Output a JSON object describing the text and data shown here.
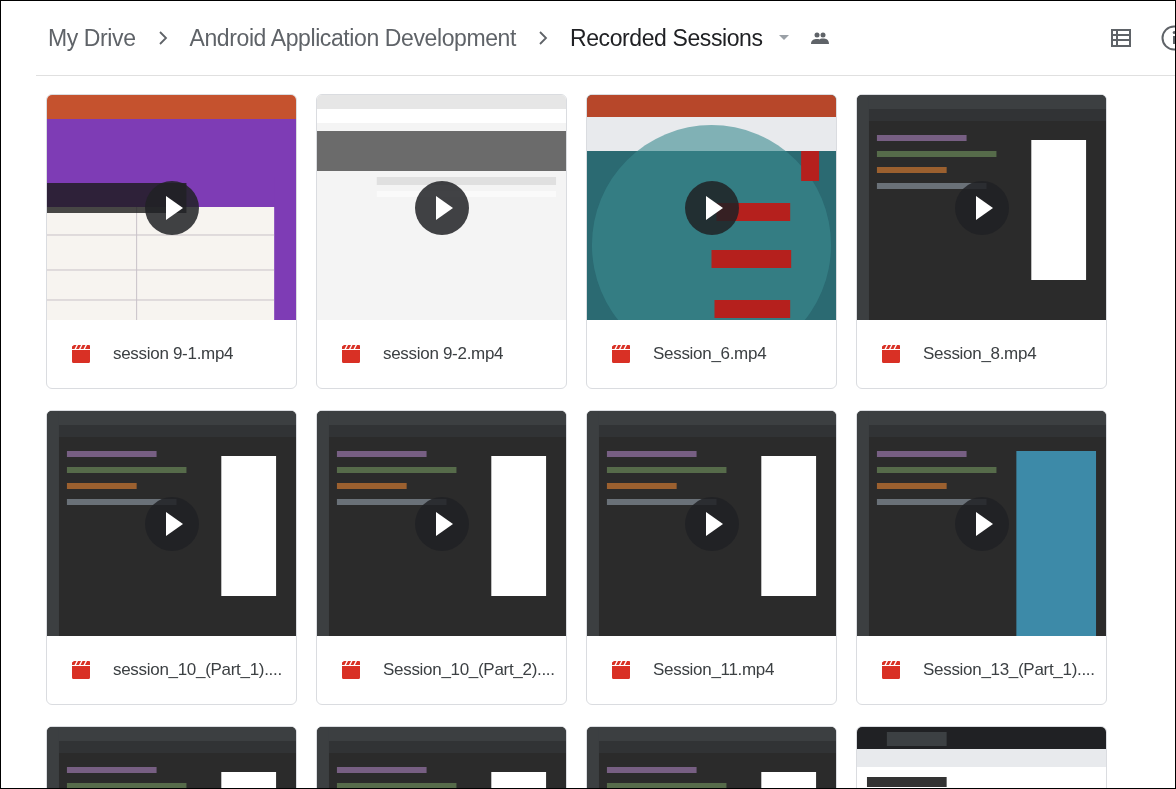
{
  "breadcrumb": [
    {
      "label": "My Drive",
      "current": false
    },
    {
      "label": "Android Application Development",
      "current": false
    },
    {
      "label": "Recorded Sessions",
      "current": true
    }
  ],
  "files": [
    {
      "name": "session 9-1.mp4",
      "kind": "video"
    },
    {
      "name": "session 9-2.mp4",
      "kind": "video"
    },
    {
      "name": "Session_6.mp4",
      "kind": "video"
    },
    {
      "name": "Session_8.mp4",
      "kind": "video"
    },
    {
      "name": "session_10_(Part_1)....",
      "kind": "video"
    },
    {
      "name": "Session_10_(Part_2)....",
      "kind": "video"
    },
    {
      "name": "Session_11.mp4",
      "kind": "video"
    },
    {
      "name": "Session_13_(Part_1)....",
      "kind": "video"
    },
    {
      "kind": "picture"
    },
    {
      "kind": "picture"
    },
    {
      "kind": "picture"
    },
    {
      "kind": "picture"
    }
  ]
}
